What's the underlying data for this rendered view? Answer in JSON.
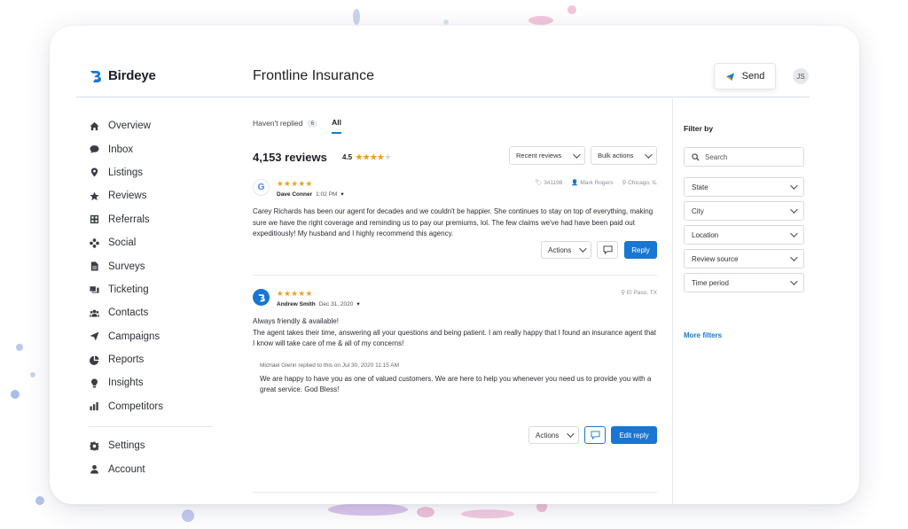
{
  "app": {
    "brand": "Birdeye",
    "business_name": "Frontline Insurance",
    "send_label": "Send",
    "user_initials": "JS",
    "accent_color": "#1976d2",
    "star_color": "#f29b11"
  },
  "sidebar": {
    "items": [
      {
        "label": "Overview",
        "icon": "home-icon"
      },
      {
        "label": "Inbox",
        "icon": "chat-bubble-icon"
      },
      {
        "label": "Listings",
        "icon": "location-pin-icon"
      },
      {
        "label": "Reviews",
        "icon": "star-icon"
      },
      {
        "label": "Referrals",
        "icon": "referral-icon"
      },
      {
        "label": "Social",
        "icon": "social-network-icon"
      },
      {
        "label": "Surveys",
        "icon": "document-icon"
      },
      {
        "label": "Ticketing",
        "icon": "tickets-icon"
      },
      {
        "label": "Contacts",
        "icon": "contacts-icon"
      },
      {
        "label": "Campaigns",
        "icon": "paper-plane-icon"
      },
      {
        "label": "Reports",
        "icon": "pie-chart-icon"
      },
      {
        "label": "Insights",
        "icon": "lightbulb-icon"
      },
      {
        "label": "Competitors",
        "icon": "bar-chart-icon"
      }
    ],
    "bottom_items": [
      {
        "label": "Settings",
        "icon": "gear-icon"
      },
      {
        "label": "Account",
        "icon": "user-icon"
      }
    ]
  },
  "tabs": [
    {
      "label": "Haven't replied",
      "count": "6",
      "active": false
    },
    {
      "label": "All",
      "count": "",
      "active": true
    }
  ],
  "summary": {
    "count": "4,153 reviews",
    "rating": "4.5",
    "sort_label": "Recent reviews",
    "bulk_label": "Bulk actions"
  },
  "reviews": [
    {
      "source_icon": "google-icon",
      "stars": 5,
      "author": "Dave Conner",
      "time": "1:02 PM",
      "meta": [
        {
          "icon": "tag-icon",
          "text": "341198"
        },
        {
          "icon": "person-icon",
          "text": "Mark Rogers"
        },
        {
          "icon": "location-icon",
          "text": "Chicago, IL"
        }
      ],
      "text": "Carey Richards has been our agent for decades and we couldn't be happier. She continues to stay on top of everything, making sure we have the right coverage and reminding us to pay our premiums, lol. The few claims we've had have been paid out expeditiously! My husband and I highly recommend this agency.",
      "actions_label": "Actions",
      "primary_label": "Reply"
    },
    {
      "source_icon": "birdeye-icon",
      "stars": 5,
      "author": "Andrew Smith",
      "time": "Dec 31, 2020",
      "meta": [
        {
          "icon": "location-icon",
          "text": "El Paso, TX"
        }
      ],
      "text_lines": [
        "Always friendly & available!",
        "The agent takes their time, answering all your questions and being patient. I am really happy that I found an insurance agent that I know will take care of me & all of my concerns!"
      ],
      "reply_meta": "Michael Glenn replied to this on Jul 30, 2020 11:15 AM",
      "reply_text": "We are happy to have you as one of valued customers. We are here to help you whenever you need us to provide you with a great service. God Bless!",
      "actions_label": "Actions",
      "primary_label": "Edit reply"
    }
  ],
  "filters": {
    "title": "Filter by",
    "search_placeholder": "Search",
    "selects": [
      "State",
      "City",
      "Location",
      "Review source",
      "Time period"
    ],
    "more_label": "More filters"
  }
}
